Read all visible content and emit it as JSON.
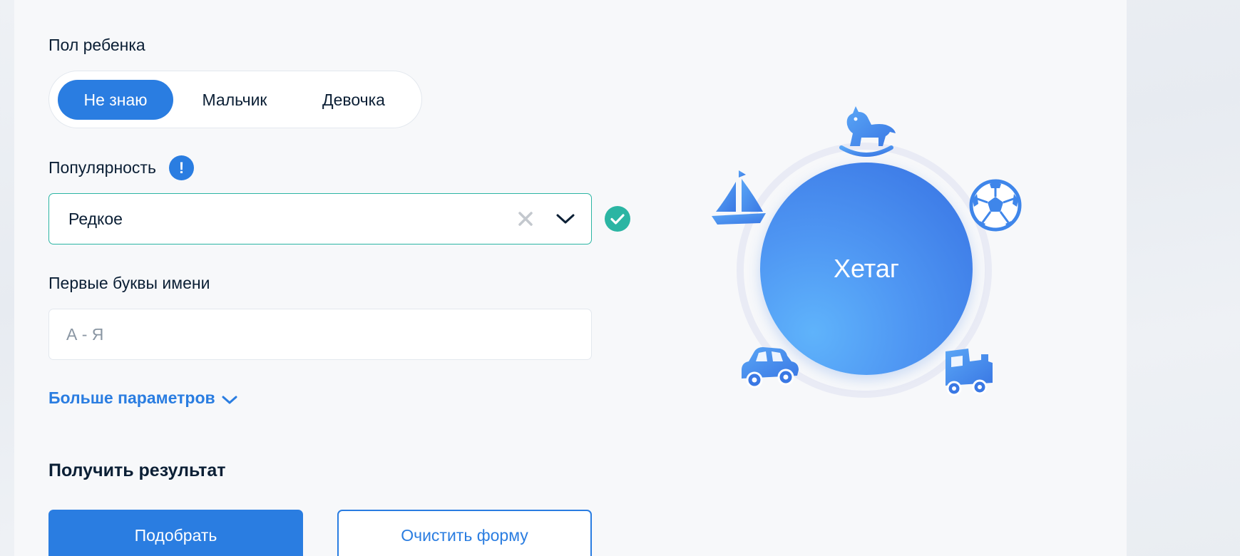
{
  "form": {
    "gender": {
      "label": "Пол ребенка",
      "options": [
        "Не знаю",
        "Мальчик",
        "Девочка"
      ],
      "selected": "Не знаю"
    },
    "popularity": {
      "label": "Популярность",
      "info_glyph": "!",
      "value": "Редкое"
    },
    "letters": {
      "label": "Первые буквы имени",
      "placeholder": "А - Я",
      "value": ""
    },
    "more_params": "Больше параметров",
    "result_title": "Получить результат",
    "submit_label": "Подобрать",
    "clear_label": "Очистить форму"
  },
  "illustration": {
    "name": "Хетаг",
    "toys": [
      "rocking-horse-icon",
      "sailboat-icon",
      "soccer-ball-icon",
      "toy-car-icon",
      "toy-train-icon"
    ]
  },
  "colors": {
    "accent": "#2a7de1",
    "success": "#2bb5a3",
    "text": "#0b1f35"
  }
}
